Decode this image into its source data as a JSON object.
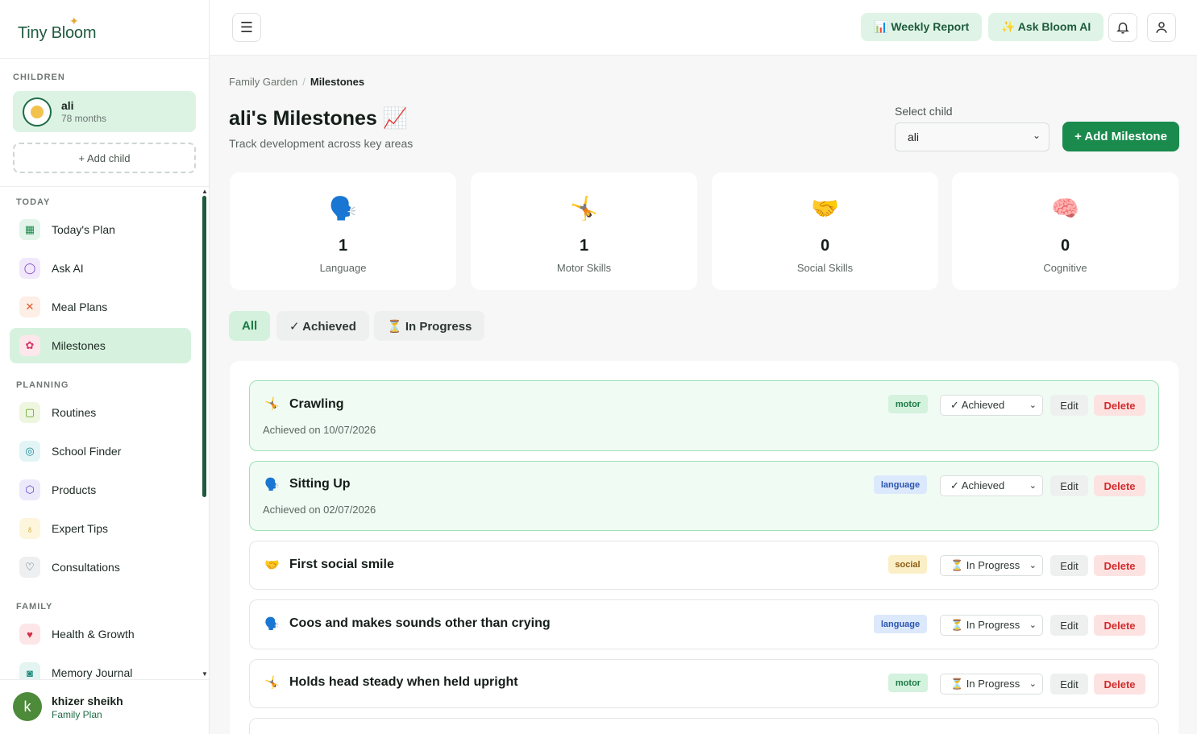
{
  "app": {
    "logo": "Tiny Bloom"
  },
  "sidebar": {
    "children_label": "CHILDREN",
    "child": {
      "name": "ali",
      "age": "78 months"
    },
    "add_child": "+  Add child",
    "sections": {
      "today": "TODAY",
      "planning": "PLANNING",
      "family": "FAMILY"
    },
    "items": [
      {
        "label": "Today's Plan",
        "icon": "grid-icon"
      },
      {
        "label": "Ask AI",
        "icon": "chat-bubble-icon"
      },
      {
        "label": "Meal Plans",
        "icon": "utensils-icon"
      },
      {
        "label": "Milestones",
        "icon": "flower-icon"
      },
      {
        "label": "Routines",
        "icon": "clipboard-icon"
      },
      {
        "label": "School Finder",
        "icon": "compass-icon"
      },
      {
        "label": "Products",
        "icon": "box-icon"
      },
      {
        "label": "Expert Tips",
        "icon": "lightbulb-icon"
      },
      {
        "label": "Consultations",
        "icon": "stethoscope-icon"
      },
      {
        "label": "Health & Growth",
        "icon": "heart-pulse-icon"
      },
      {
        "label": "Memory Journal",
        "icon": "camera-icon"
      }
    ],
    "user": {
      "initial": "k",
      "name": "khizer sheikh",
      "plan": "Family Plan"
    }
  },
  "header": {
    "weekly_report": "📊 Weekly Report",
    "ask_bloom": "✨ Ask Bloom AI"
  },
  "breadcrumb": {
    "root": "Family Garden",
    "current": "Milestones"
  },
  "page": {
    "title": "ali's Milestones 📈",
    "subtitle": "Track development across key areas",
    "select_label": "Select child",
    "select_value": "ali",
    "add_button": "+ Add Milestone"
  },
  "stats": [
    {
      "emoji": "🗣️",
      "value": "1",
      "label": "Language"
    },
    {
      "emoji": "🤸",
      "value": "1",
      "label": "Motor Skills"
    },
    {
      "emoji": "🤝",
      "value": "0",
      "label": "Social Skills"
    },
    {
      "emoji": "🧠",
      "value": "0",
      "label": "Cognitive"
    }
  ],
  "filters": [
    "All",
    "✓ Achieved",
    "⏳ In Progress"
  ],
  "milestones": [
    {
      "emoji": "🤸",
      "title": "Crawling",
      "date": "Achieved on 10/07/2026",
      "tag": "motor",
      "status": "✓ Achieved",
      "edit": "Edit",
      "delete": "Delete"
    },
    {
      "emoji": "🗣️",
      "title": "Sitting Up",
      "date": "Achieved on 02/07/2026",
      "tag": "language",
      "status": "✓ Achieved",
      "edit": "Edit",
      "delete": "Delete"
    },
    {
      "emoji": "🤝",
      "title": "First social smile",
      "tag": "social",
      "status": "⏳ In Progress",
      "edit": "Edit",
      "delete": "Delete"
    },
    {
      "emoji": "🗣️",
      "title": "Coos and makes sounds other than crying",
      "tag": "language",
      "status": "⏳ In Progress",
      "edit": "Edit",
      "delete": "Delete"
    },
    {
      "emoji": "🤸",
      "title": "Holds head steady when held upright",
      "tag": "motor",
      "status": "⏳ In Progress",
      "edit": "Edit",
      "delete": "Delete"
    }
  ],
  "colors": {
    "brand": "#1a8a4d",
    "brand_light": "#d6f2de",
    "danger": "#d12c2c"
  }
}
